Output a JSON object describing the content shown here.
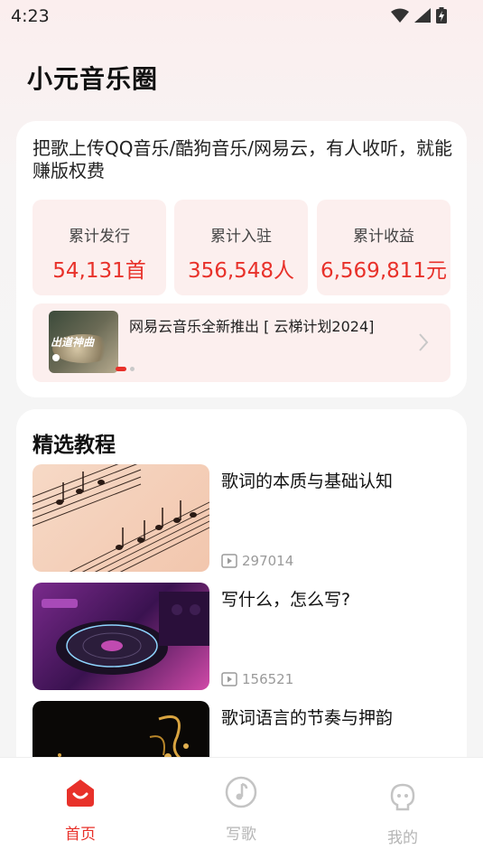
{
  "status_bar": {
    "time": "4:23"
  },
  "app": {
    "title": "小元音乐圈"
  },
  "intro": {
    "text": "把歌上传QQ音乐/酷狗音乐/网易云，有人收听，就能赚版权费"
  },
  "stats": [
    {
      "label": "累计发行",
      "value": "54,131首"
    },
    {
      "label": "累计入驻",
      "value": "356,548人"
    },
    {
      "label": "累计收益",
      "value": "6,569,811元"
    }
  ],
  "banner": {
    "text": "网易云音乐全新推出 [ 云梯计划2024]",
    "thumb_text": "出道神曲"
  },
  "section": {
    "title": "精选教程"
  },
  "tutorials": [
    {
      "title": "歌词的本质与基础认知",
      "views": "297014"
    },
    {
      "title": "写什么，怎么写?",
      "views": "156521"
    },
    {
      "title": "歌词语言的节奏与押韵",
      "views": ""
    }
  ],
  "tabs": [
    {
      "label": "首页",
      "icon": "home-icon",
      "active": true
    },
    {
      "label": "写歌",
      "icon": "music-note-icon",
      "active": false
    },
    {
      "label": "我的",
      "icon": "profile-icon",
      "active": false
    }
  ],
  "colors": {
    "accent": "#e8312a",
    "stat_bg": "#fcefee",
    "inactive": "#b5b5b5"
  }
}
